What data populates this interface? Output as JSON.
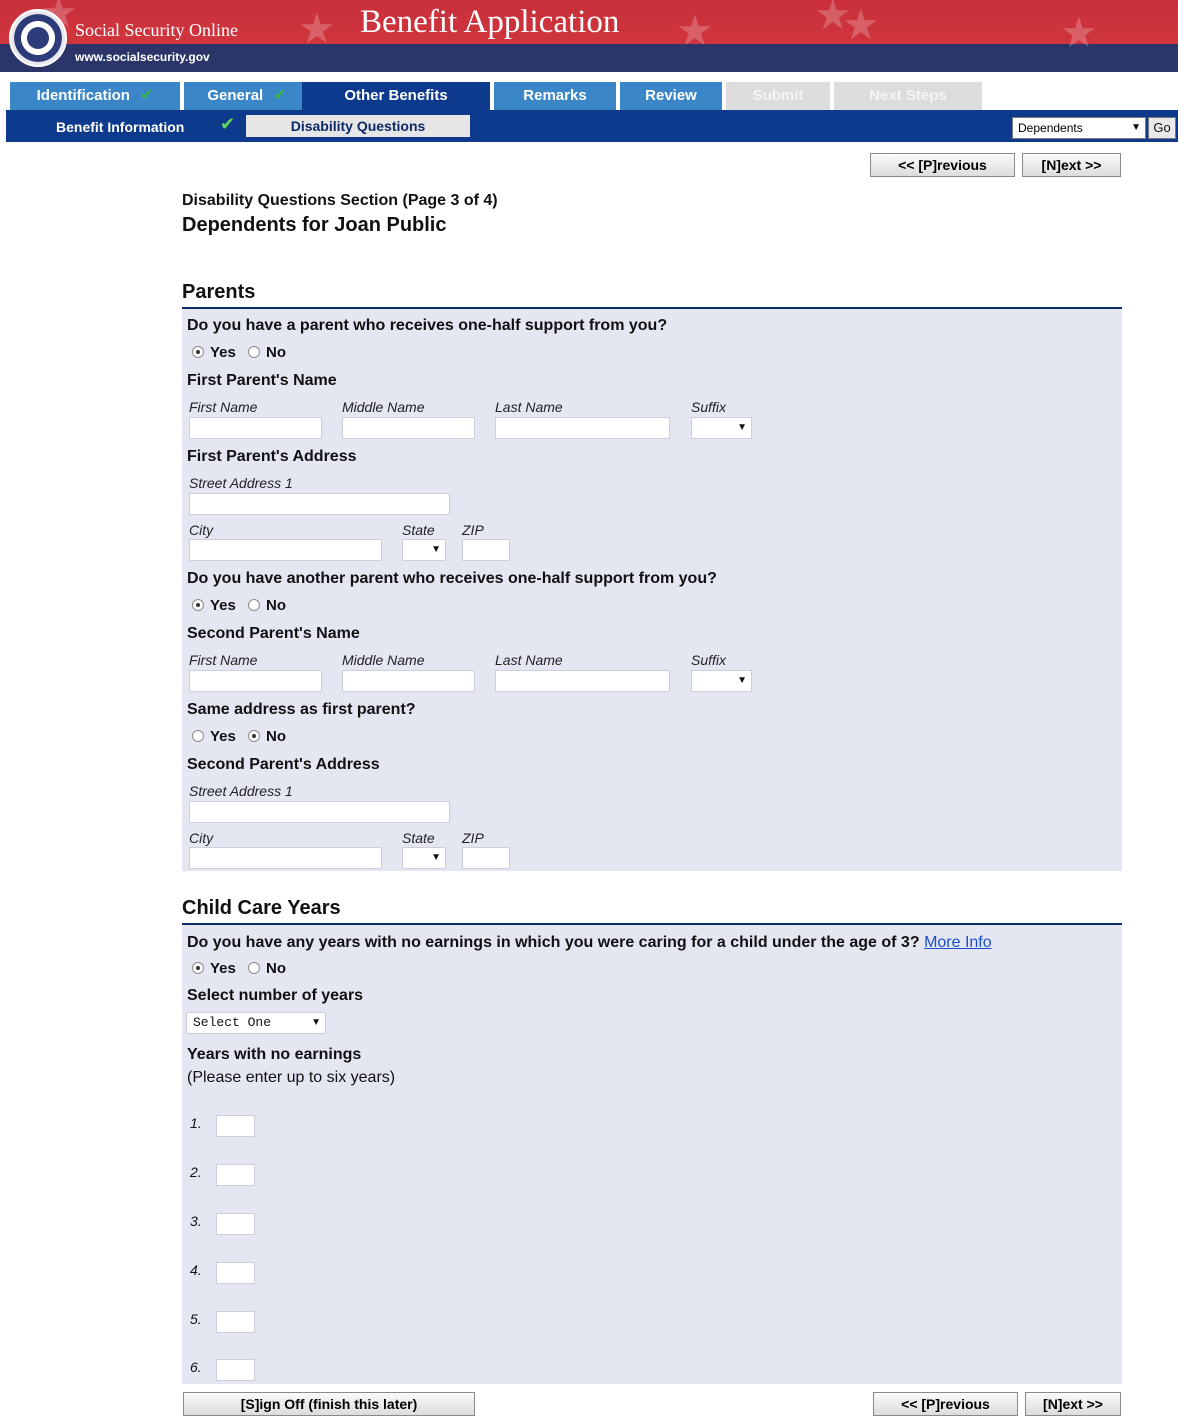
{
  "header": {
    "site_title": "Social Security Online",
    "site_url": "www.socialsecurity.gov",
    "app_title": "Benefit Application"
  },
  "tabs": [
    {
      "label": "Identification",
      "state": "complete"
    },
    {
      "label": "General",
      "state": "complete"
    },
    {
      "label": "Other Benefits",
      "state": "active"
    },
    {
      "label": "Remarks",
      "state": "available"
    },
    {
      "label": "Review",
      "state": "available"
    },
    {
      "label": "Submit",
      "state": "disabled"
    },
    {
      "label": "Next Steps",
      "state": "disabled"
    }
  ],
  "subnav": {
    "benefit_information": "Benefit Information",
    "disability_questions": "Disability Questions",
    "jump_select_value": "Dependents",
    "go_label": "Go"
  },
  "nav": {
    "previous": "<< [P]revious",
    "next": "[N]ext >>",
    "sign_off": "[S]ign Off (finish this later)"
  },
  "page": {
    "subtitle": "Disability Questions Section (Page 3 of 4)",
    "title": "Dependents for Joan Public"
  },
  "parents": {
    "heading": "Parents",
    "q1": "Do you have a parent who receives one-half support from you?",
    "q1_answer": "Yes",
    "first_name_heading": "First Parent's Name",
    "first_address_heading": "First Parent's Address",
    "q2": "Do you have another parent who receives one-half support from you?",
    "q2_answer": "Yes",
    "second_name_heading": "Second Parent's Name",
    "same_address_q": "Same address as first parent?",
    "same_address_answer": "No",
    "second_address_heading": "Second Parent's Address"
  },
  "labels": {
    "first_name": "First Name",
    "middle_name": "Middle Name",
    "last_name": "Last Name",
    "suffix": "Suffix",
    "street1": "Street Address 1",
    "city": "City",
    "state": "State",
    "zip": "ZIP",
    "yes": "Yes",
    "no": "No"
  },
  "childcare": {
    "heading": "Child Care Years",
    "question": "Do you have any years with no earnings in which you were caring for a child under the age of 3?",
    "more_info": "More Info",
    "answer": "Yes",
    "select_years_label": "Select number of years",
    "select_years_value": "Select One",
    "years_heading": "Years with no earnings",
    "years_hint": "(Please enter up to six years)",
    "year_numbers": [
      "1.",
      "2.",
      "3.",
      "4.",
      "5.",
      "6."
    ]
  }
}
